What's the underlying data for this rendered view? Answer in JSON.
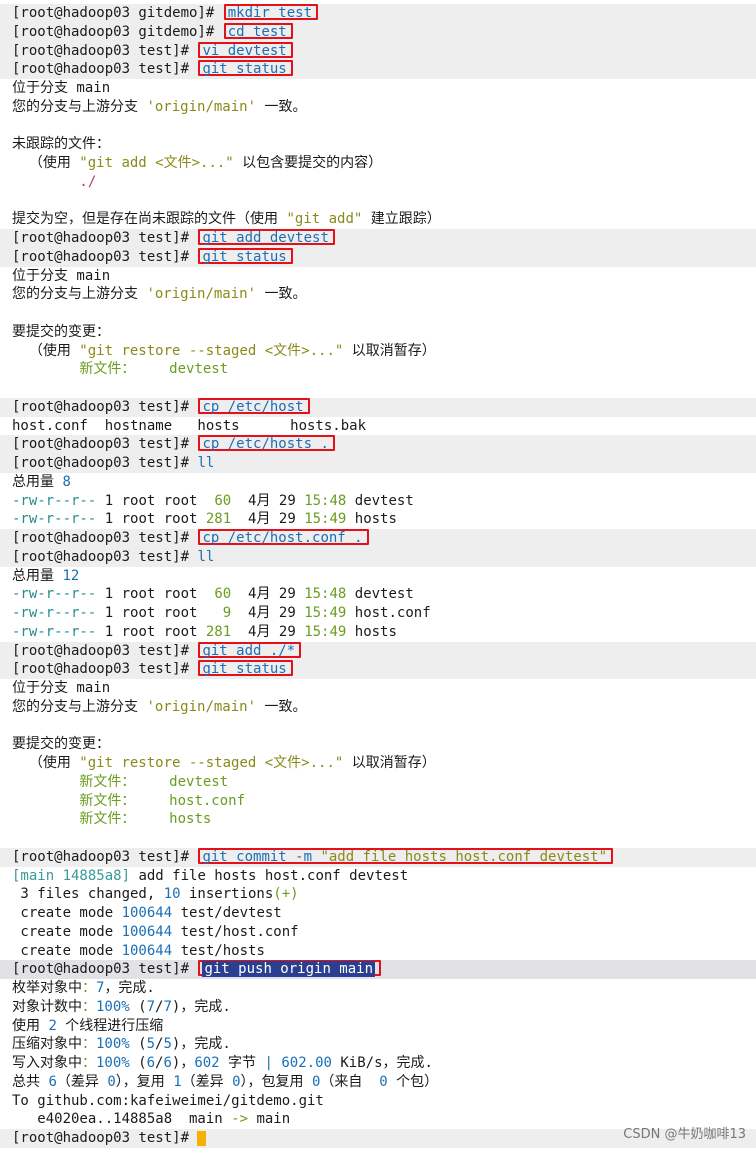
{
  "prompt_gitdemo": "[root@hadoop03 gitdemo]# ",
  "prompt_test": "[root@hadoop03 test]# ",
  "lines": {
    "l0": "mkdir test",
    "l1": "cd test",
    "l2": "vi devtest",
    "l3": "git status",
    "l4": "位于分支 main",
    "l5a": "您的分支与上游分支 ",
    "l5b": "'origin/main'",
    "l5c": " 一致。",
    "l7": "未跟踪的文件：",
    "l8a": "  （使用 ",
    "l8b": "\"git add <文件>...\"",
    "l8c": " 以包含要提交的内容）",
    "l9": "        ./",
    "l11a": "提交为空，但是存在尚未跟踪的文件（使用 ",
    "l11b": "\"git add\"",
    "l11c": " 建立跟踪）",
    "l12": "git add devtest",
    "l13": "git status",
    "l14": "位于分支 main",
    "l17": "要提交的变更：",
    "l18a": "  （使用 ",
    "l18b": "\"git restore --staged <文件>...\"",
    "l18c": " 以取消暂存）",
    "l19a": "        新文件：",
    "l19b": "    devtest",
    "l21": "cp /etc/host",
    "l22": "host.conf  hostname   hosts      hosts.bak",
    "l23": "cp /etc/hosts .",
    "l24": "ll",
    "l25a": "总用量 ",
    "l25b": "8",
    "l26a": "-rw-r--r--",
    "l26b": " 1 root root  ",
    "l26c": "60",
    "l26d": "  4月 29 ",
    "l26e": "15:48",
    "l26f": " devtest",
    "l27a": "-rw-r--r--",
    "l27b": " 1 root root ",
    "l27c": "281",
    "l27d": "  4月 29 ",
    "l27e": "15:49",
    "l27f": " hosts",
    "l28": "cp /etc/host.conf .",
    "l29": "ll",
    "l30b": "12",
    "l31c": "60",
    "l32b": " 1 root root   ",
    "l32c": "9",
    "l32f": " host.conf",
    "l33c": "281",
    "l34": "git add ./*",
    "l35": "git status",
    "l41b": "    host.conf",
    "l42b": "    hosts",
    "l44a": "git commit -m ",
    "l44b": "\"add file hosts host.conf devtest\"",
    "l45a": "[main 14885a8]",
    "l45b": " add file hosts host.conf devtest",
    "l46a": " 3 files changed, ",
    "l46b": "10",
    "l46c": " insertions",
    "l46d": "(+)",
    "l47a": " create mode ",
    "l47b": "100644",
    "l47c": " test/devtest",
    "l48c": " test/host.conf",
    "l49c": " test/hosts",
    "l50": "git push origin main",
    "l51a": "枚举对象中",
    "l51b": "：",
    "l51c": "7",
    "l51d": "，完成.",
    "l52a": "对象计数中",
    "l52b": "：",
    "l52c": "100%",
    "l52d": " (",
    "l52e": "7",
    "l52f": "/",
    "l52g": "7",
    "l52h": ")，完成.",
    "l53a": "使用 ",
    "l53b": "2",
    "l53c": " 个线程进行压缩",
    "l54a": "压缩对象中",
    "l54e": "5",
    "l54g": "5",
    "l55a": "写入对象中",
    "l55e": "6",
    "l55g": "6",
    "l55h": ")，",
    "l55i": "602",
    "l55j": " 字节 ",
    "l55k": "|",
    "l55l": " 602.00",
    "l55m": " KiB/s，完成.",
    "l56a": "总共 ",
    "l56b": "6",
    "l56c": "（差异 ",
    "l56d": "0",
    "l56e": "），复用 ",
    "l56f": "1",
    "l56h": "0",
    "l56i": "），包复用 ",
    "l56j": "0",
    "l56k": "（来自  ",
    "l56l": "0",
    "l56m": " 个包）",
    "l57": "To github.com:kafeiweimei/gitdemo.git",
    "l58a": "   e4020ea..14885a8  main ",
    "l58b": "->",
    "l58c": " main"
  },
  "watermark": "CSDN @牛奶咖啡13",
  "colors": {
    "highlight_box": "#e3121a",
    "command": "#1a6fb5",
    "cursor": "#f5b000"
  }
}
